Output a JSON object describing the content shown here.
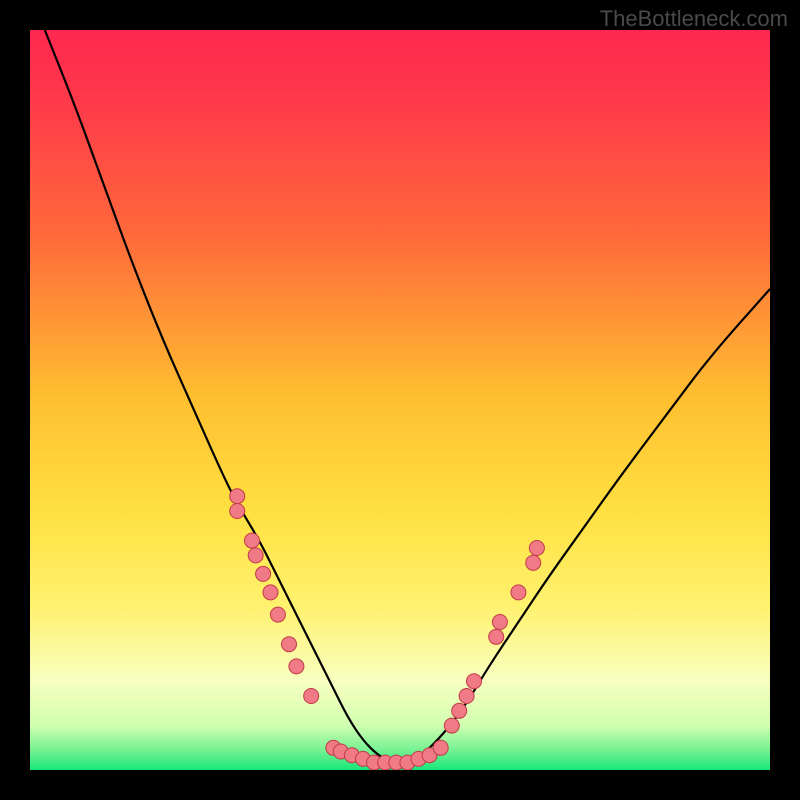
{
  "watermark": "TheBottleneck.com",
  "colors": {
    "bg_black": "#000000",
    "grad_top": "#ff2850",
    "grad_upper_mid": "#ff6a3a",
    "grad_mid": "#ffd030",
    "grad_lower_mid": "#fff270",
    "grad_pale": "#f8ffc0",
    "grad_green": "#16e87a",
    "curve": "#000000",
    "marker_fill": "#f07a85",
    "marker_stroke": "#c23a48"
  },
  "chart_data": {
    "type": "line",
    "title": "",
    "xlabel": "",
    "ylabel": "",
    "xlim": [
      0,
      100
    ],
    "ylim": [
      0,
      100
    ],
    "series": [
      {
        "name": "bottleneck-curve",
        "x": [
          2,
          6,
          10,
          14,
          18,
          22,
          26,
          28,
          31,
          33,
          35,
          37,
          39,
          41,
          43,
          45,
          47,
          49,
          51,
          53,
          56,
          59,
          62,
          66,
          70,
          75,
          80,
          86,
          92,
          100
        ],
        "y": [
          100,
          90,
          79,
          68,
          58,
          49,
          40,
          36,
          31,
          27,
          23,
          19,
          15,
          11,
          7,
          4,
          2,
          1,
          1,
          2,
          5,
          9,
          14,
          20,
          26,
          33,
          40,
          48,
          56,
          65
        ]
      }
    ],
    "markers": [
      {
        "name": "left-cluster",
        "points": [
          {
            "x": 28,
            "y": 37
          },
          {
            "x": 28,
            "y": 35
          },
          {
            "x": 30,
            "y": 31
          },
          {
            "x": 30.5,
            "y": 29
          },
          {
            "x": 31.5,
            "y": 26.5
          },
          {
            "x": 32.5,
            "y": 24
          },
          {
            "x": 33.5,
            "y": 21
          },
          {
            "x": 35,
            "y": 17
          },
          {
            "x": 36,
            "y": 14
          },
          {
            "x": 38,
            "y": 10
          }
        ]
      },
      {
        "name": "bottom-cluster",
        "points": [
          {
            "x": 41,
            "y": 3
          },
          {
            "x": 42,
            "y": 2.5
          },
          {
            "x": 43.5,
            "y": 2
          },
          {
            "x": 45,
            "y": 1.5
          },
          {
            "x": 46.5,
            "y": 1
          },
          {
            "x": 48,
            "y": 1
          },
          {
            "x": 49.5,
            "y": 1
          },
          {
            "x": 51,
            "y": 1
          },
          {
            "x": 52.5,
            "y": 1.5
          },
          {
            "x": 54,
            "y": 2
          },
          {
            "x": 55.5,
            "y": 3
          }
        ]
      },
      {
        "name": "right-cluster",
        "points": [
          {
            "x": 57,
            "y": 6
          },
          {
            "x": 58,
            "y": 8
          },
          {
            "x": 59,
            "y": 10
          },
          {
            "x": 60,
            "y": 12
          },
          {
            "x": 63,
            "y": 18
          },
          {
            "x": 63.5,
            "y": 20
          },
          {
            "x": 66,
            "y": 24
          },
          {
            "x": 68,
            "y": 28
          },
          {
            "x": 68.5,
            "y": 30
          }
        ]
      }
    ],
    "gradient_stops": [
      {
        "offset": 0,
        "color": "#ff2850"
      },
      {
        "offset": 0.1,
        "color": "#ff3a4a"
      },
      {
        "offset": 0.28,
        "color": "#ff6a3a"
      },
      {
        "offset": 0.5,
        "color": "#ffc030"
      },
      {
        "offset": 0.65,
        "color": "#ffe040"
      },
      {
        "offset": 0.78,
        "color": "#fff270"
      },
      {
        "offset": 0.88,
        "color": "#f8ffc0"
      },
      {
        "offset": 0.94,
        "color": "#d0ffb0"
      },
      {
        "offset": 0.975,
        "color": "#70f090"
      },
      {
        "offset": 1.0,
        "color": "#16e87a"
      }
    ]
  }
}
